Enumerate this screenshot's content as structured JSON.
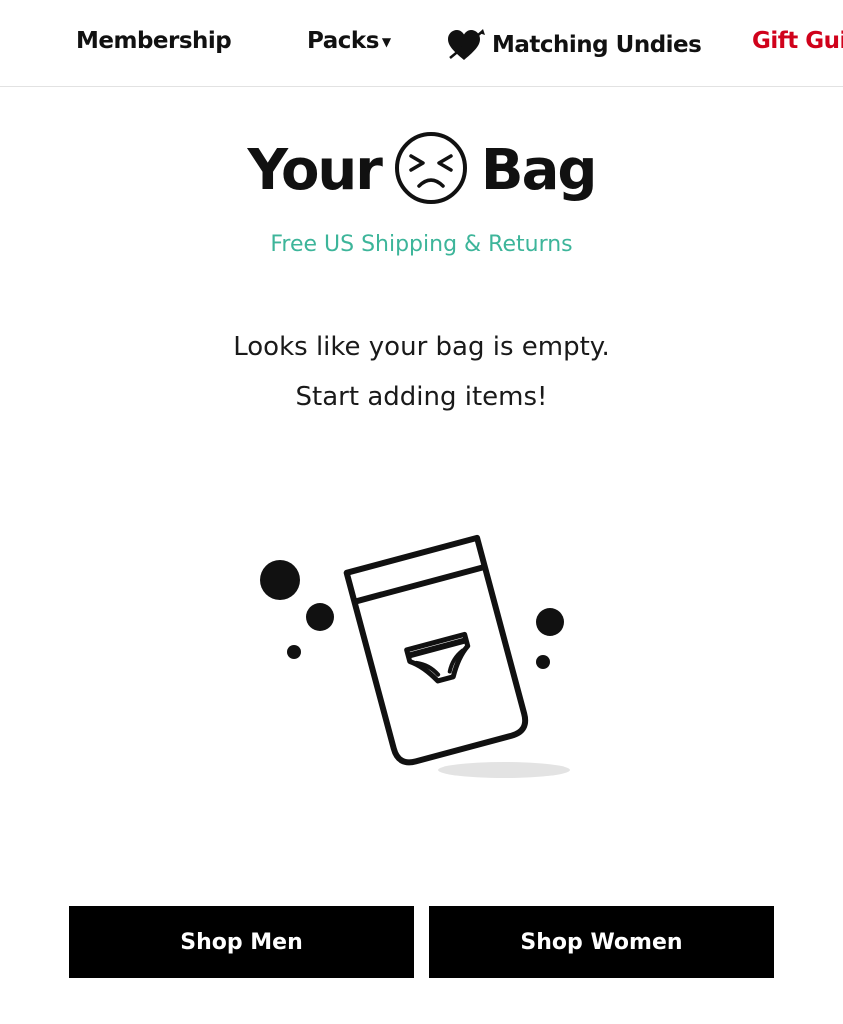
{
  "nav": {
    "items": [
      {
        "label": "Membership"
      },
      {
        "label": "Packs"
      },
      {
        "label": "Matching Undies",
        "icon": "heart-arrow-icon"
      },
      {
        "label": "Gift Guide"
      }
    ],
    "gift_color": "#d0021b"
  },
  "bag": {
    "title_left": "Your",
    "title_right": "Bag",
    "face_icon": "sad-face-icon",
    "shipping": "Free US Shipping & Returns",
    "empty_line1": "Looks like your bag is empty.",
    "empty_line2": "Start adding items!",
    "illustration": "empty-bag-illustration"
  },
  "actions": {
    "shop_men": "Shop Men",
    "shop_women": "Shop Women"
  },
  "colors": {
    "accent": "#3db59a",
    "button_bg": "#000000",
    "button_text": "#ffffff"
  }
}
